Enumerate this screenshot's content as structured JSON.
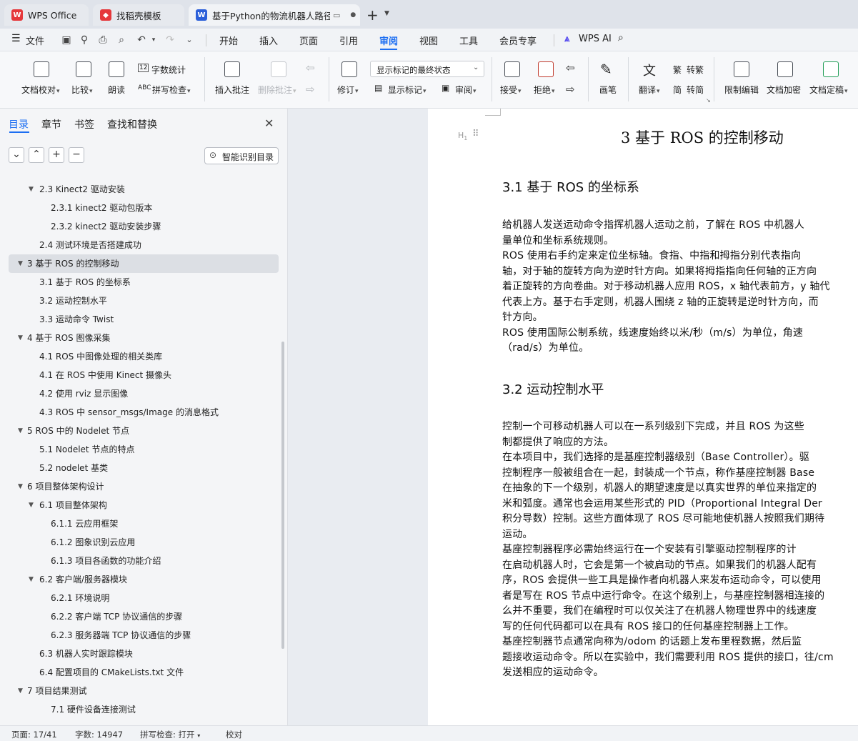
{
  "tabs": [
    {
      "label": "WPS Office",
      "icon": "wps-logo-icon",
      "color": "#e5383b"
    },
    {
      "label": "找稻壳模板",
      "icon": "daoke-logo-icon",
      "color": "#e5383b"
    },
    {
      "label": "基于Python的物流机器人路径",
      "icon": "word-doc-icon",
      "color": "#2b5fd9"
    }
  ],
  "menu": {
    "file": "文件",
    "items": [
      "开始",
      "插入",
      "页面",
      "引用",
      "审阅",
      "视图",
      "工具",
      "会员专享"
    ],
    "active": "审阅",
    "ai": "WPS AI"
  },
  "ribbon": {
    "doc_proof": "文档校对",
    "compare": "比较",
    "read_aloud": "朗读",
    "word_count": "字数统计",
    "spell_check": "拼写检查",
    "insert_comment": "插入批注",
    "delete_comment": "删除批注",
    "track": "修订",
    "display_mode": "显示标记的最终状态",
    "show_markup": "显示标记",
    "review": "审阅",
    "accept": "接受",
    "reject": "拒绝",
    "pen": "画笔",
    "translate": "翻译",
    "to_traditional": "转繁",
    "to_simplified": "转简",
    "restrict_edit": "限制编辑",
    "encrypt": "文档加密",
    "finalize": "文档定稿"
  },
  "sidebar": {
    "tabs": [
      "目录",
      "章节",
      "书签",
      "查找和替换"
    ],
    "active_tab": "目录",
    "smart_toc": "智能识别目录",
    "toc": [
      {
        "text": "2.3 Kinect2 驱动安装",
        "level": 2,
        "expanded": true
      },
      {
        "text": "2.3.1 kinect2 驱动包版本",
        "level": 3
      },
      {
        "text": "2.3.2 kinect2 驱动安装步骤",
        "level": 3
      },
      {
        "text": "2.4  测试环境是否搭建成功",
        "level": 2
      },
      {
        "text": "3   基于 ROS 的控制移动",
        "level": 1,
        "expanded": true,
        "selected": true
      },
      {
        "text": "3.1  基于 ROS 的坐标系",
        "level": 2
      },
      {
        "text": "3.2  运动控制水平",
        "level": 2
      },
      {
        "text": "3.3 运动命令 Twist",
        "level": 2
      },
      {
        "text": "4   基于 ROS 图像采集",
        "level": 1,
        "expanded": true
      },
      {
        "text": "4.1 ROS 中图像处理的相关类库",
        "level": 2
      },
      {
        "text": "4.1  在 ROS 中使用 Kinect 摄像头",
        "level": 2
      },
      {
        "text": "4.2  使用 rviz 显示图像",
        "level": 2
      },
      {
        "text": "4.3 ROS 中 sensor_msgs/Image 的消息格式",
        "level": 2
      },
      {
        "text": "5   ROS 中的 Nodelet 节点",
        "level": 1,
        "expanded": true
      },
      {
        "text": "5.1 Nodelet 节点的特点",
        "level": 2
      },
      {
        "text": "5.2 nodelet 基类",
        "level": 2
      },
      {
        "text": "6   项目整体架构设计",
        "level": 1,
        "expanded": true
      },
      {
        "text": "6.1  项目整体架构",
        "level": 2,
        "expanded": true
      },
      {
        "text": "6.1.1  云应用框架",
        "level": 3
      },
      {
        "text": "6.1.2  图象识别云应用",
        "level": 3
      },
      {
        "text": "6.1.3  项目各函数的功能介绍",
        "level": 3
      },
      {
        "text": "6.2  客户端/服务器模块",
        "level": 2,
        "expanded": true
      },
      {
        "text": "6.2.1 环境说明",
        "level": 3
      },
      {
        "text": "6.2.2 客户端 TCP 协议通信的步骤",
        "level": 3
      },
      {
        "text": "6.2.3 服务器端 TCP 协议通信的步骤",
        "level": 3
      },
      {
        "text": "6.3  机器人实时跟踪模块",
        "level": 2
      },
      {
        "text": "6.4  配置项目的 CMakeLists.txt 文件",
        "level": 2
      },
      {
        "text": "7   项目结果测试",
        "level": 1,
        "expanded": true
      },
      {
        "text": "7.1 硬件设备连接测试",
        "level": 3
      }
    ]
  },
  "document": {
    "chapter_title": "3   基于 ROS 的控制移动",
    "h_31": "3.1  基于 ROS 的坐标系",
    "h_32": "3.2  运动控制水平",
    "lines_31": [
      "      给机器人发送运动命令指挥机器人运动之前，了解在 ROS 中机器人",
      "量单位和坐标系统规则。",
      "      ROS 使用右手约定来定位坐标轴。食指、中指和拇指分别代表指向",
      "轴，对于轴的旋转方向为逆时针方向。如果将拇指指向任何轴的正方向",
      "着正旋转的方向卷曲。对于移动机器人应用 ROS，x 轴代表前方，y 轴代",
      "代表上方。基于右手定则，机器人围绕 z 轴的正旋转是逆时针方向，而",
      "针方向。",
      "      ROS 使用国际公制系统，线速度始终以米/秒（m/s）为单位，角速",
      "（rad/s）为单位。"
    ],
    "lines_32": [
      "      控制一个可移动机器人可以在一系列级别下完成，并且 ROS 为这些",
      "制都提供了响应的方法。",
      "      在本项目中，我们选择的是基座控制器级别（Base Controller）。驱",
      "控制程序一般被组合在一起，封装成一个节点，称作基座控制器 Base",
      "在抽象的下一个级别，机器人的期望速度是以真实世界的单位来指定的",
      "米和弧度。通常也会运用某些形式的 PID（Proportional Integral Der",
      "积分导数）控制。这些方面体现了 ROS 尽可能地使机器人按照我们期待",
      "运动。",
      "      基座控制器程序必需始终运行在一个安装有引擎驱动控制程序的计",
      "在启动机器人时，它会是第一个被启动的节点。如果我们的机器人配有",
      "序，ROS 会提供一些工具是操作者向机器人来发布运动命令，可以使用",
      "者是写在 ROS 节点中运行命令。在这个级别上，与基座控制器相连接的",
      "么并不重要，我们在编程时可以仅关注了在机器人物理世界中的线速度",
      "写的任何代码都可以在具有 ROS 接口的任何基座控制器上工作。",
      "      基座控制器节点通常向称为/odom 的话题上发布里程数据，然后监",
      "题接收运动命令。所以在实验中，我们需要利用 ROS 提供的接口，往/cm",
      "发送相应的运动命令。"
    ]
  },
  "status": {
    "page": "页面: 17/41",
    "words": "字数: 14947",
    "spell": "拼写检查: 打开",
    "proof": "校对"
  },
  "colors": {
    "accent": "#1c6ef2",
    "brand_red": "#e5383b"
  }
}
